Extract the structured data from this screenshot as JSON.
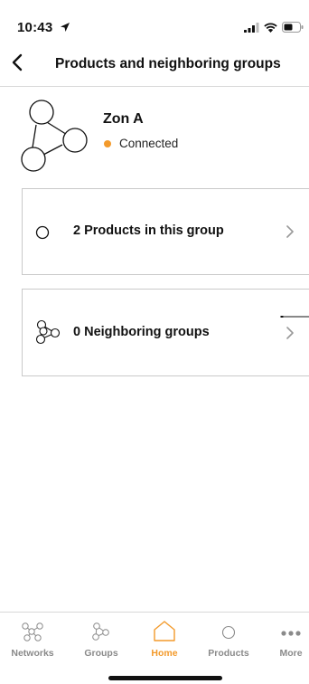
{
  "status_bar": {
    "time": "10:43"
  },
  "header": {
    "title": "Products and neighboring groups"
  },
  "group": {
    "name": "Zon A",
    "status": "Connected",
    "status_color": "#f39a2b"
  },
  "cards": {
    "products": {
      "label": "2 Products in this group"
    },
    "neighbors": {
      "label": "0 Neighboring groups"
    }
  },
  "tabs": [
    {
      "label": "Networks",
      "icon": "networks-icon"
    },
    {
      "label": "Groups",
      "icon": "groups-icon"
    },
    {
      "label": "Home",
      "icon": "home-icon",
      "active": true
    },
    {
      "label": "Products",
      "icon": "products-icon"
    },
    {
      "label": "More",
      "icon": "more-icon"
    }
  ],
  "colors": {
    "accent": "#f39a2b",
    "text": "#111111",
    "muted": "#8a8a8a"
  }
}
